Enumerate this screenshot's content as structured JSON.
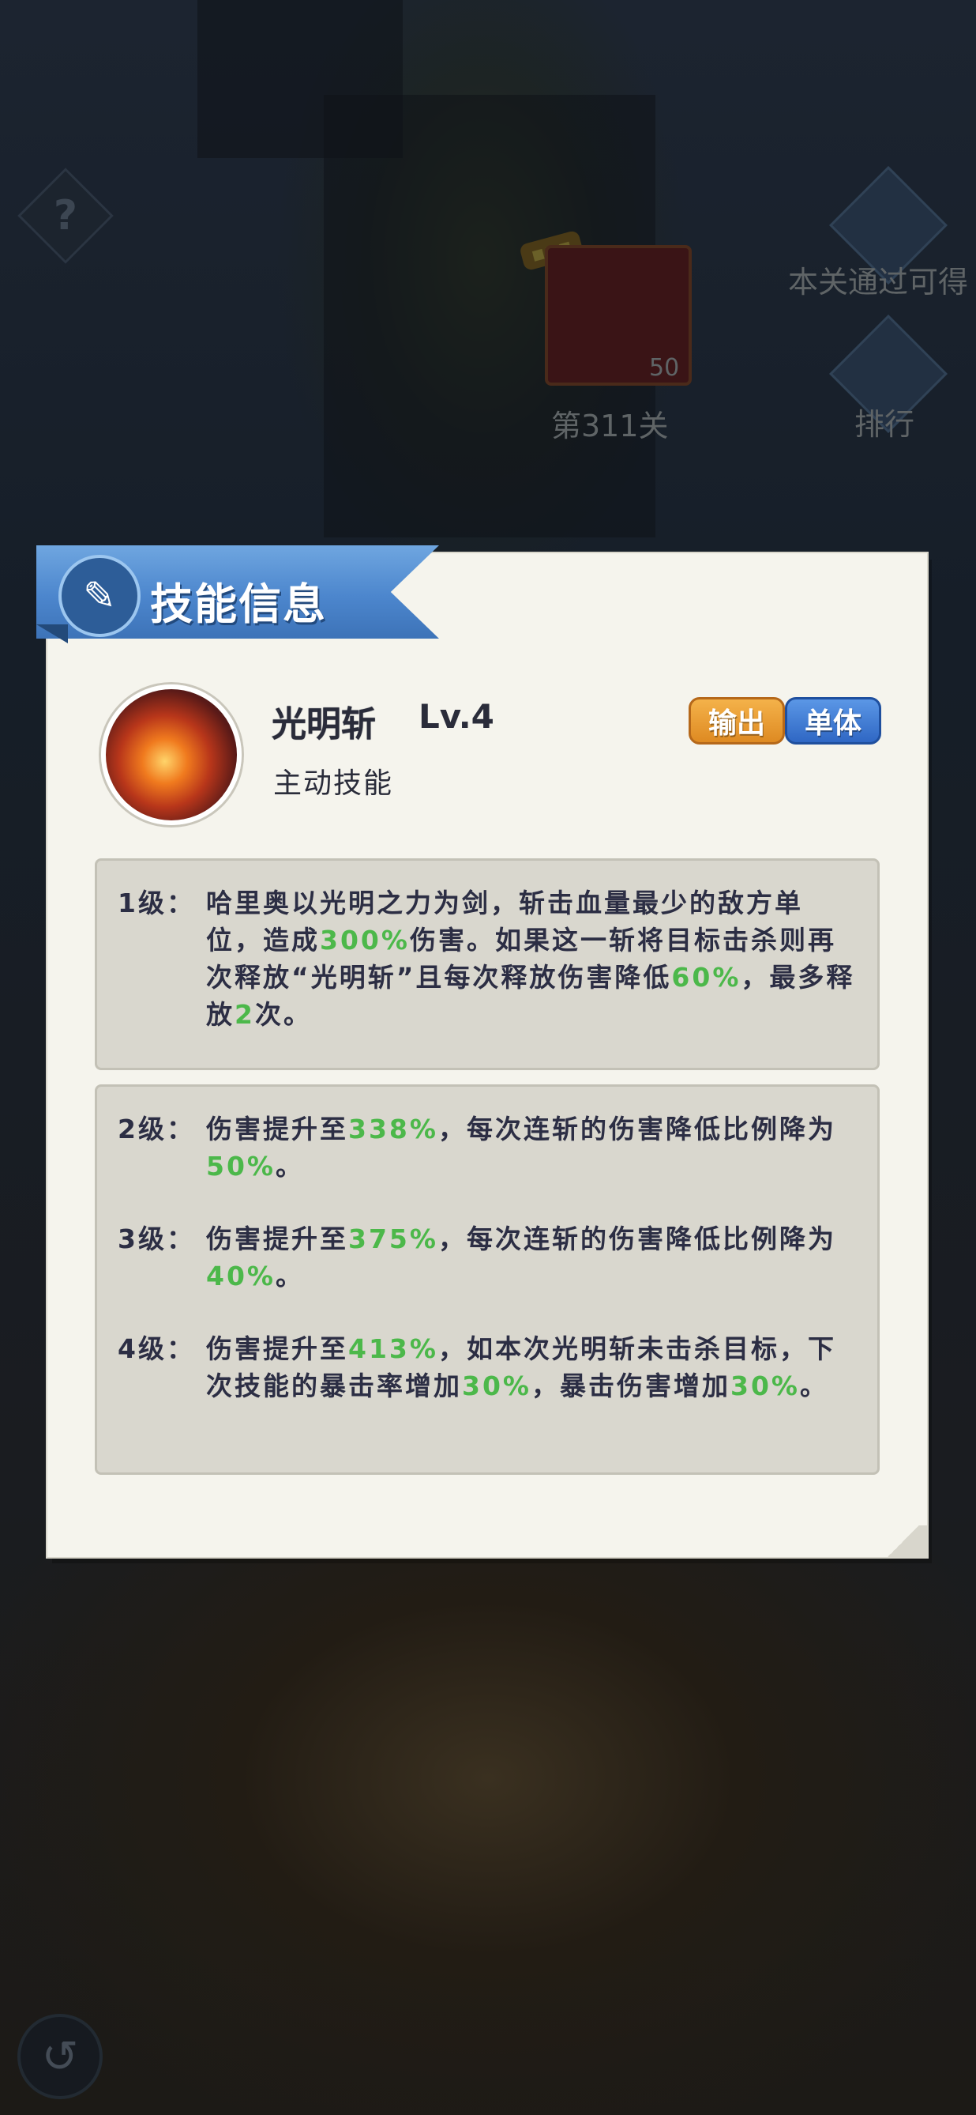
{
  "background": {
    "stage_label": "第311关",
    "reward_count": "50",
    "reward_text": "本关通过可得",
    "rank_label": "排行",
    "help_icon": "question-icon",
    "back_icon": "back-arrow-icon"
  },
  "dialog": {
    "title": "技能信息",
    "title_icon": "scroll-icon",
    "skill": {
      "name": "光明斩",
      "level": "Lv.4",
      "type": "主动技能",
      "tags": [
        "输出",
        "单体"
      ]
    },
    "levels": [
      {
        "label": "1级：",
        "parts": [
          "哈里奥以光明之力为剑，斩击血量最少的敌方单位，造成",
          "300%",
          "伤害。如果这一斩将目标击杀则再次释放“光明斩”且每次释放伤害降低",
          "60%",
          "，最多释放",
          "2",
          "次。"
        ]
      },
      {
        "label": "2级：",
        "parts": [
          "伤害提升至",
          "338%",
          "，每次连斩的伤害降低比例降为",
          "50%",
          "。"
        ]
      },
      {
        "label": "3级：",
        "parts": [
          "伤害提升至",
          "375%",
          "，每次连斩的伤害降低比例降为",
          "40%",
          "。"
        ]
      },
      {
        "label": "4级：",
        "parts": [
          "伤害提升至",
          "413%",
          "，如本次光明斩未击杀目标，下次技能的暴击率增加",
          "30%",
          "，暴击伤害增加",
          "30%",
          "。"
        ]
      }
    ],
    "colors": {
      "highlight": "#4cb84a",
      "ribbon": "#4c86cd",
      "tag_output": "#de8a22",
      "tag_single": "#2f67c4"
    }
  }
}
